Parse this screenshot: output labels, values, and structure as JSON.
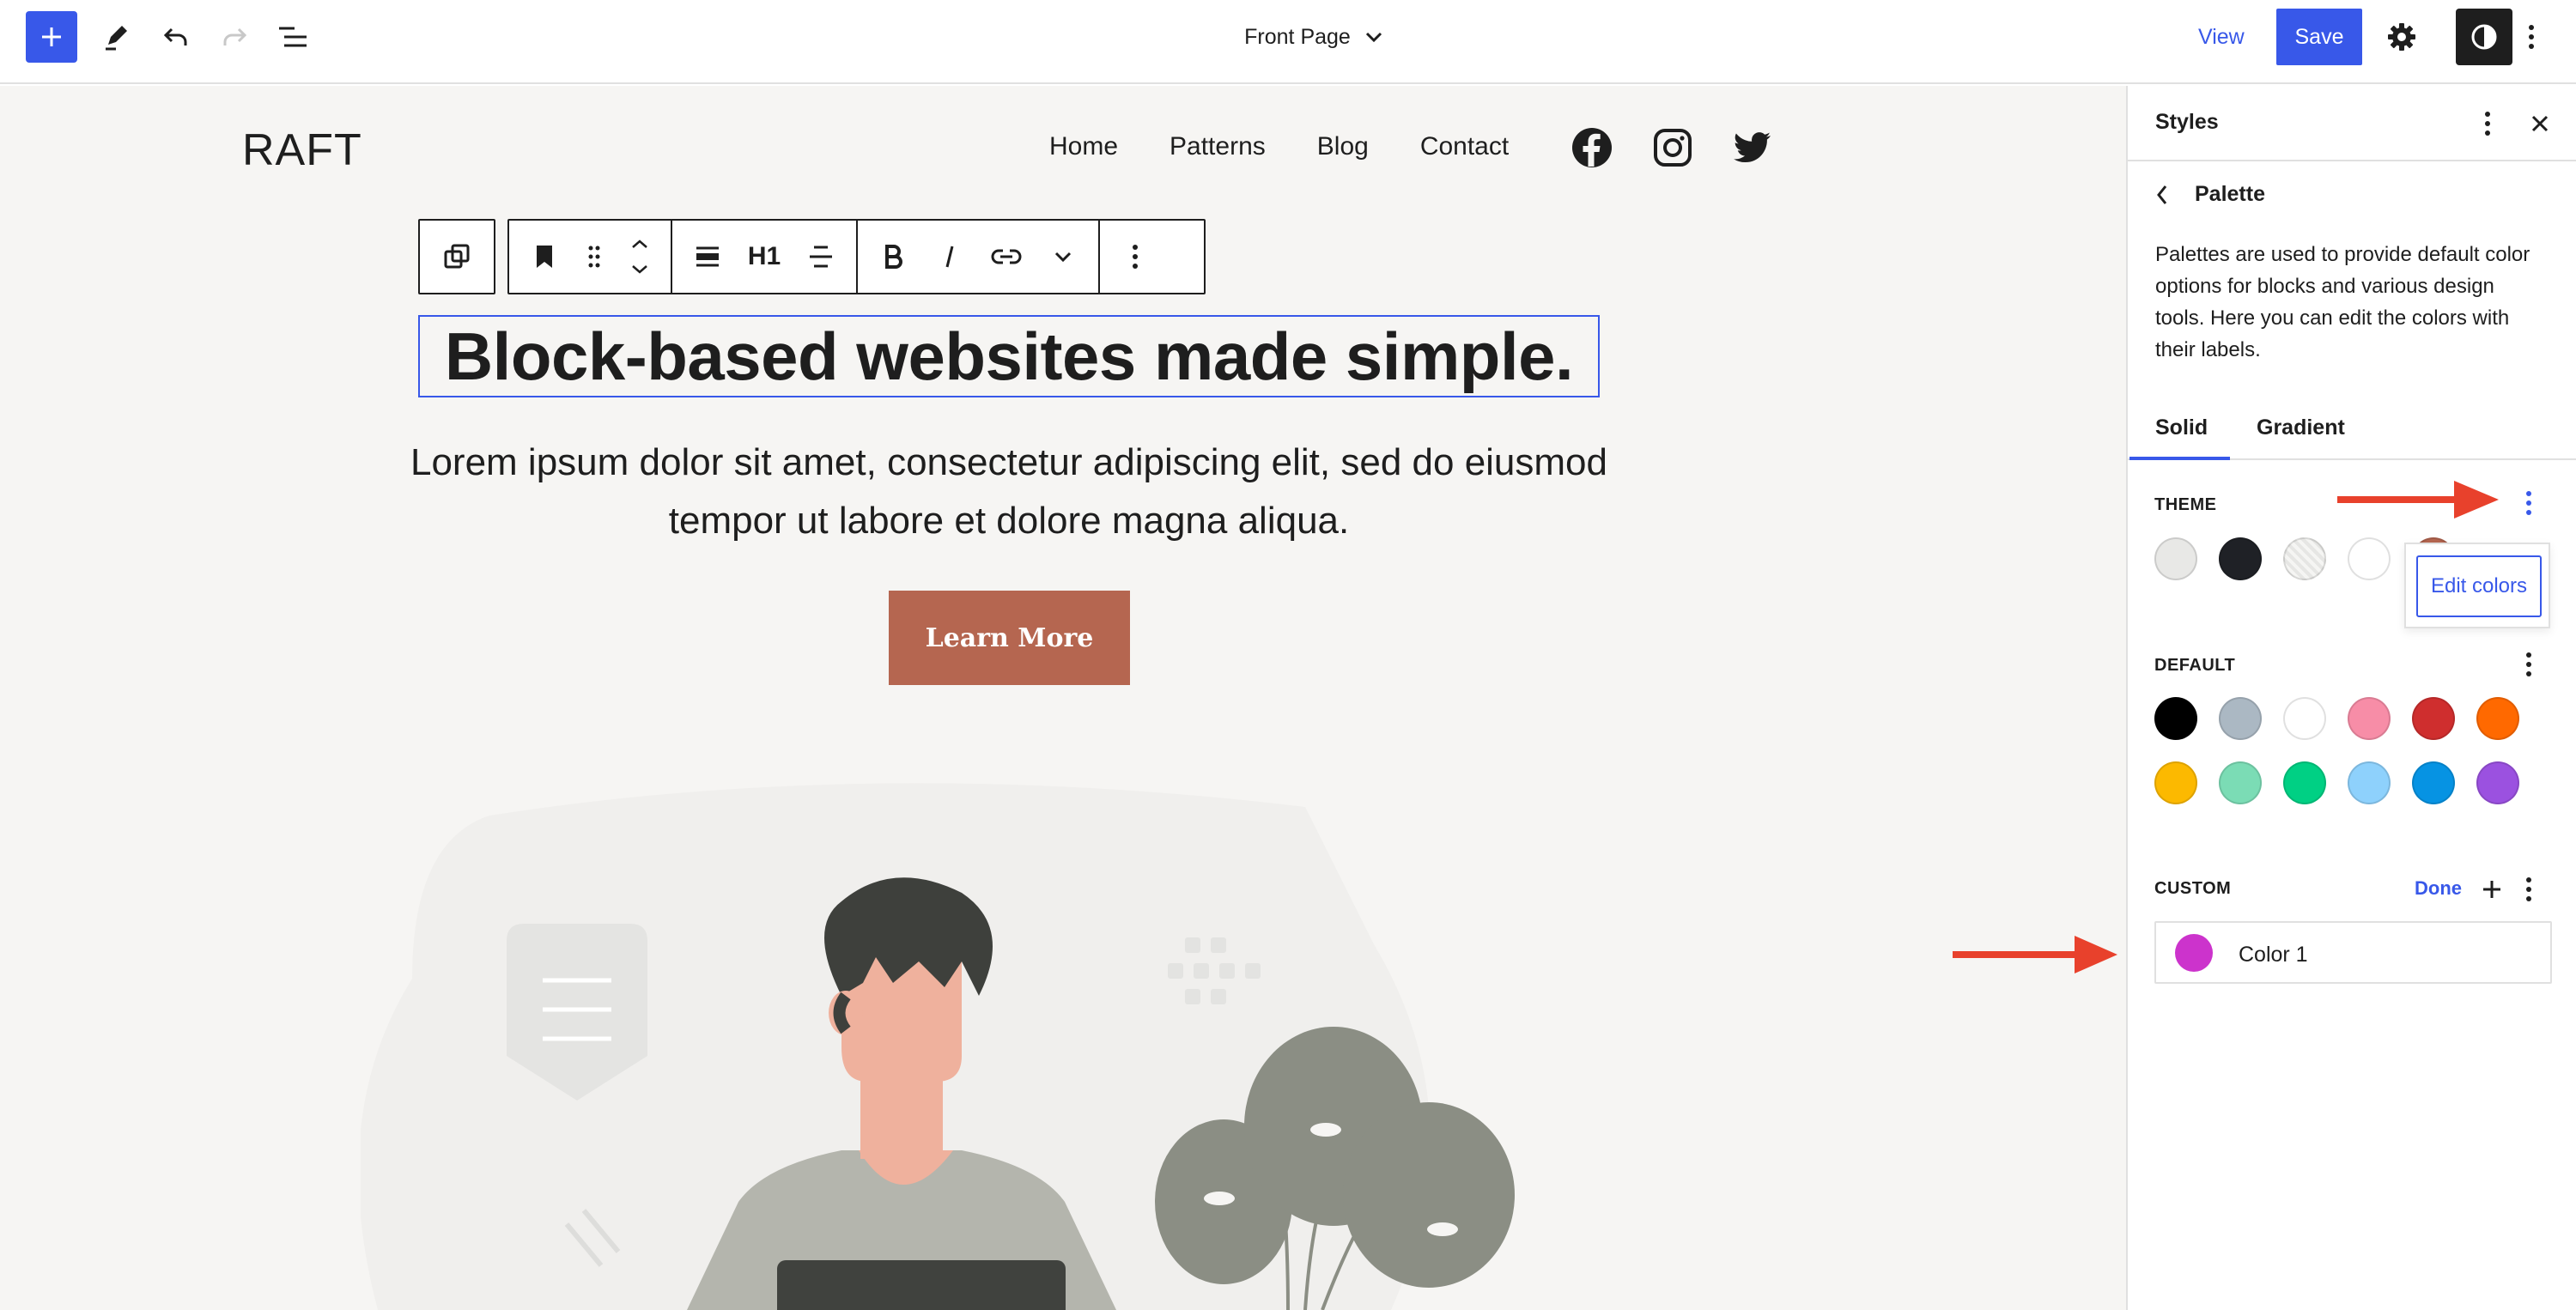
{
  "topbar": {
    "document_title": "Front Page",
    "view_label": "View",
    "save_label": "Save"
  },
  "site": {
    "title": "RAFT",
    "nav": [
      "Home",
      "Patterns",
      "Blog",
      "Contact"
    ]
  },
  "block_toolbar": {
    "heading_level": "H1"
  },
  "content": {
    "heading": "Block-based websites made simple.",
    "lead": "Lorem ipsum dolor sit amet, consectetur adipiscing elit, sed do eiusmod tempor ut labore et dolore magna aliqua.",
    "cta_label": "Learn More"
  },
  "sidebar": {
    "title": "Styles",
    "panel_title": "Palette",
    "description": "Palettes are used to provide default color options for blocks and various design tools. Here you can edit the colors with their labels.",
    "tabs": [
      "Solid",
      "Gradient"
    ],
    "active_tab": "Solid",
    "theme": {
      "label": "THEME",
      "colors": [
        "#e8e8e6",
        "#1f2126",
        "#eeeeec",
        "#ffffff",
        "#b56650"
      ],
      "menu_item": "Edit colors"
    },
    "default": {
      "label": "DEFAULT",
      "colors": [
        "#000000",
        "#abb8c3",
        "#ffffff",
        "#f78da7",
        "#cf2e2e",
        "#ff6900",
        "#fcb900",
        "#7bdcb5",
        "#00d084",
        "#8ed1fc",
        "#0693e3",
        "#9b51e0"
      ]
    },
    "custom": {
      "label": "CUSTOM",
      "done_label": "Done",
      "items": [
        {
          "name": "Color 1",
          "color": "#cc33cc"
        }
      ]
    }
  },
  "colors": {
    "accent": "#3858e9",
    "canvas_bg": "#f6f5f3",
    "annotation_arrow": "#e8412c"
  }
}
